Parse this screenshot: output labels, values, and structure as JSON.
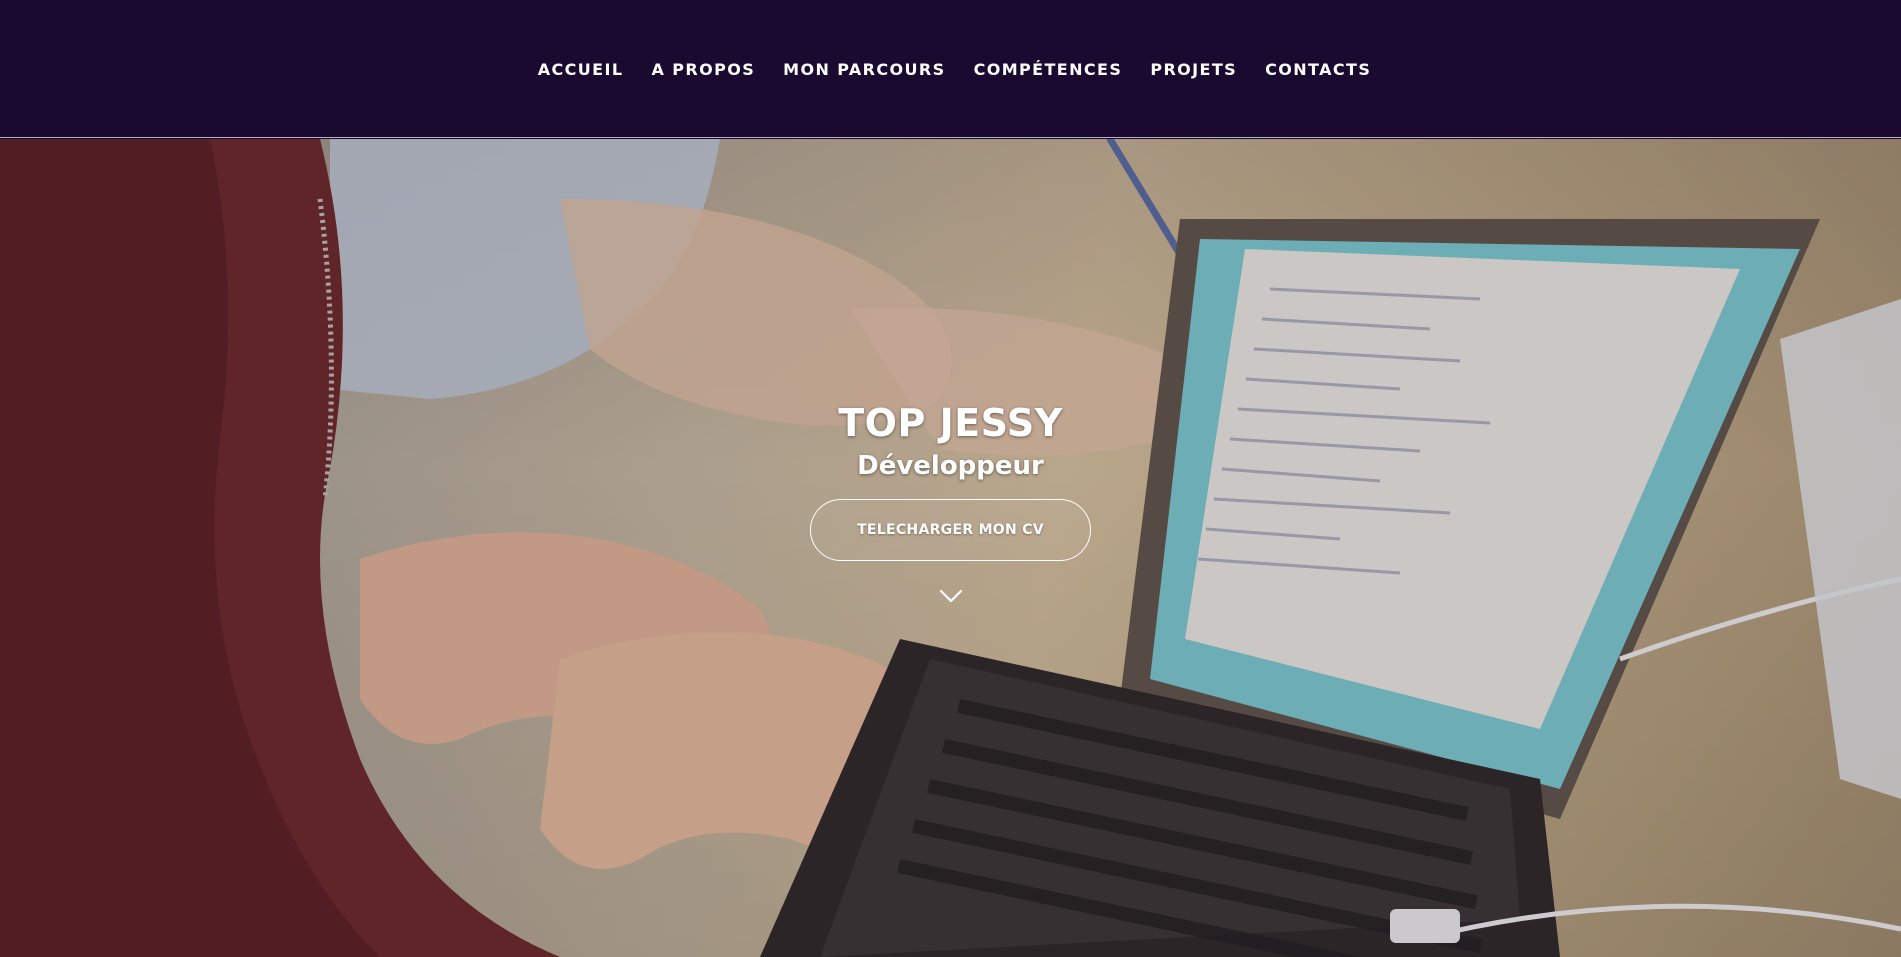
{
  "nav": {
    "items": [
      {
        "label": "ACCUEIL"
      },
      {
        "label": "A PROPOS"
      },
      {
        "label": "MON PARCOURS"
      },
      {
        "label": "COMPÉTENCES"
      },
      {
        "label": "PROJETS"
      },
      {
        "label": "CONTACTS"
      }
    ]
  },
  "hero": {
    "name": "TOP JESSY",
    "role": "Développeur",
    "cv_button_label": "TELECHARGER MON CV",
    "scroll_icon": "chevron-down-icon"
  },
  "colors": {
    "navbar_bg": "#1a0a30",
    "text": "#ffffff"
  }
}
